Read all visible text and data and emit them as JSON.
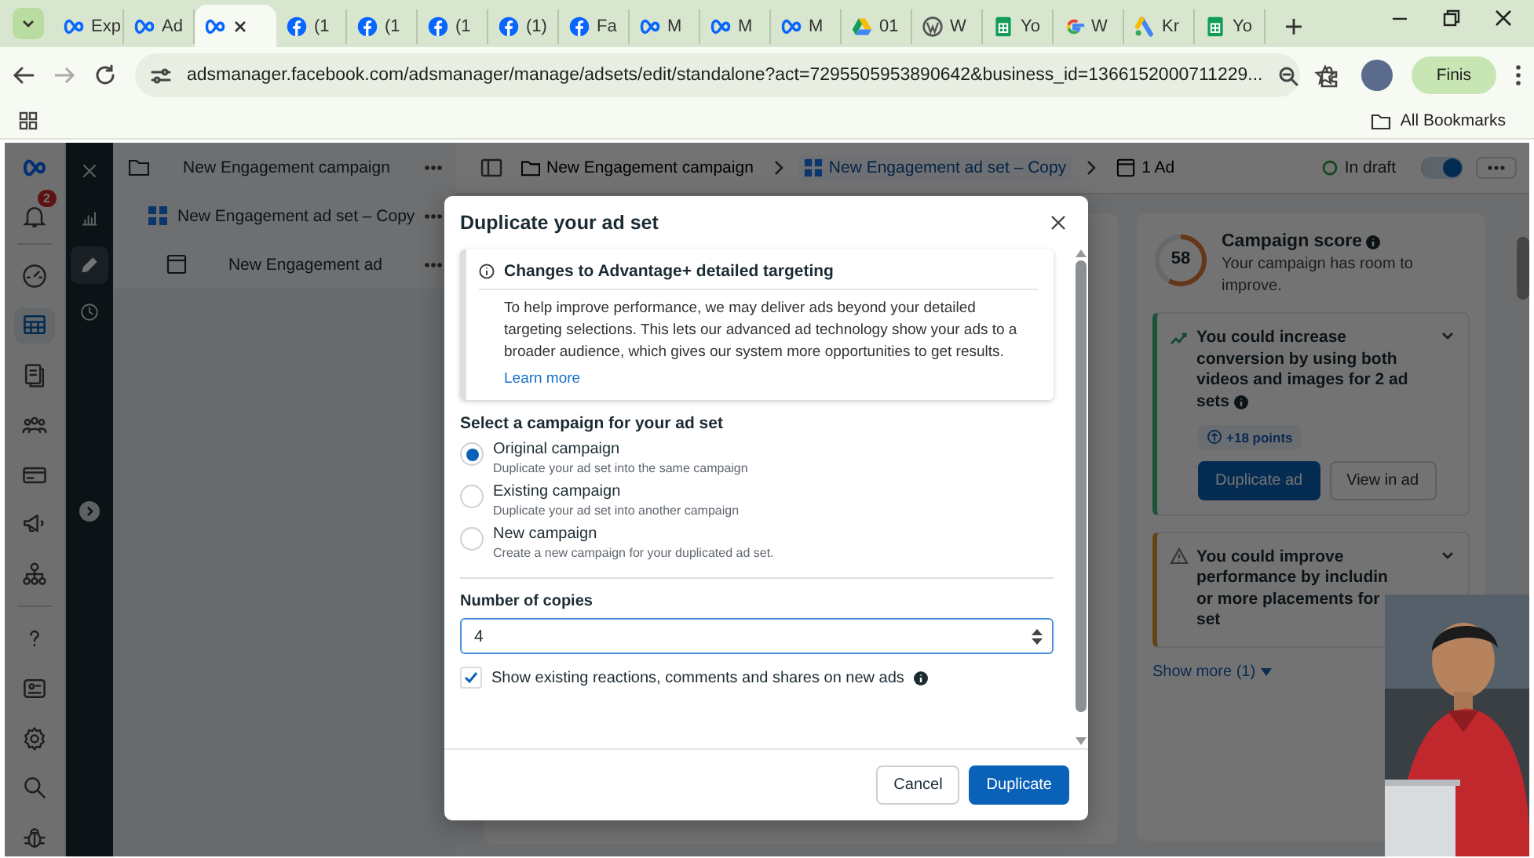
{
  "browser": {
    "tabs": [
      {
        "title": "Exp",
        "kind": "meta",
        "selected": false
      },
      {
        "title": "Ad",
        "kind": "meta",
        "selected": false
      },
      {
        "kind": "meta",
        "selected": true
      },
      {
        "title": "(1",
        "kind": "facebook",
        "selected": false
      },
      {
        "title": "(1",
        "kind": "facebook",
        "selected": false
      },
      {
        "title": "(1",
        "kind": "facebook",
        "selected": false
      },
      {
        "title": "(1)",
        "kind": "facebook",
        "selected": false
      },
      {
        "title": "Fa",
        "kind": "facebook",
        "selected": false
      },
      {
        "title": "M",
        "kind": "meta",
        "selected": false
      },
      {
        "title": "M",
        "kind": "meta",
        "selected": false
      },
      {
        "title": "M",
        "kind": "meta",
        "selected": false
      },
      {
        "title": "01",
        "kind": "drive",
        "selected": false
      },
      {
        "title": "W",
        "kind": "wordpress",
        "selected": false
      },
      {
        "title": "Yo",
        "kind": "sheets",
        "selected": false
      },
      {
        "title": "W",
        "kind": "google",
        "selected": false
      },
      {
        "title": "Kr",
        "kind": "ads",
        "selected": false
      },
      {
        "title": "Yo",
        "kind": "sheets",
        "selected": false
      }
    ],
    "address": "adsmanager.facebook.com/adsmanager/manage/adsets/edit/standalone?act=7295505953890642&business_id=1366152000711229...",
    "profile_button": "Finis",
    "all_bookmarks": "All Bookmarks"
  },
  "rail": {
    "notification_count": "2",
    "items": [
      {
        "kind": "gauge",
        "selected": false
      },
      {
        "kind": "table",
        "selected": true
      },
      {
        "kind": "pages",
        "selected": false
      },
      {
        "kind": "people",
        "selected": false
      },
      {
        "kind": "card",
        "selected": false
      },
      {
        "kind": "megaphone",
        "selected": false
      },
      {
        "kind": "network",
        "selected": false
      },
      {
        "kind": "help",
        "selected": false
      },
      {
        "kind": "idcard",
        "selected": false
      },
      {
        "kind": "gear",
        "selected": false
      },
      {
        "kind": "search",
        "selected": false
      },
      {
        "kind": "bug",
        "selected": false
      }
    ]
  },
  "strip": [
    {
      "kind": "close",
      "selected": false
    },
    {
      "kind": "chart",
      "selected": false
    },
    {
      "kind": "edit",
      "selected": true
    },
    {
      "kind": "history",
      "selected": false
    }
  ],
  "tree": [
    {
      "label": "New Engagement campaign",
      "kind": "campaign",
      "children": [
        {
          "label": "New Engagement ad set – Copy",
          "kind": "adset",
          "children": [
            {
              "label": "New Engagement ad",
              "kind": "ad"
            }
          ]
        }
      ]
    }
  ],
  "topbar": {
    "breadcrumbs": [
      {
        "label": "New Engagement campaign",
        "kind": "campaign"
      },
      {
        "label": "New Engagement ad set – Copy",
        "kind": "adset"
      },
      {
        "label": "1 Ad",
        "kind": "ad"
      }
    ],
    "status": "In draft",
    "toggle_on": true
  },
  "modal": {
    "title": "Duplicate your ad set",
    "notice": {
      "title": "Changes to Advantage+ detailed targeting",
      "body": "To help improve performance, we may deliver ads beyond your detailed targeting selections. This lets our advanced ad technology show your ads to a broader audience, which gives our system more opportunities to get results.",
      "link": "Learn more"
    },
    "campaign_label": "Select a campaign for your ad set",
    "campaign_options": [
      {
        "label": "Original campaign",
        "description": "Duplicate your ad set into the same campaign",
        "selected": true
      },
      {
        "label": "Existing campaign",
        "description": "Duplicate your ad set into another campaign",
        "selected": false
      },
      {
        "label": "New campaign",
        "description": "Create a new campaign for your duplicated ad set.",
        "selected": false
      }
    ],
    "copies_label": "Number of copies",
    "copies_value": "4",
    "show_reactions": {
      "label": "Show existing reactions, comments and shares on new ads",
      "checked": true
    },
    "buttons": [
      {
        "label": "Cancel",
        "kind": "secondary"
      },
      {
        "label": "Duplicate",
        "kind": "primary"
      }
    ]
  },
  "score_panel": {
    "score": "58",
    "level": 0.58,
    "title": "Campaign score",
    "subtitle": "Your campaign has room to improve.",
    "recommendations": [
      {
        "kind": "opportunity",
        "lines": [
          "You could increase",
          "conversion by using both",
          "videos and images for 2 ad",
          "sets"
        ],
        "points": "+18 points",
        "buttons": [
          {
            "label": "Duplicate ad",
            "kind": "primary"
          },
          {
            "label": "View in ad",
            "kind": "secondary"
          }
        ]
      },
      {
        "kind": "warning",
        "lines": [
          "You could improve",
          "performance by includin",
          "or more placements for",
          "set"
        ]
      }
    ],
    "show_more": "Show more (1)"
  }
}
